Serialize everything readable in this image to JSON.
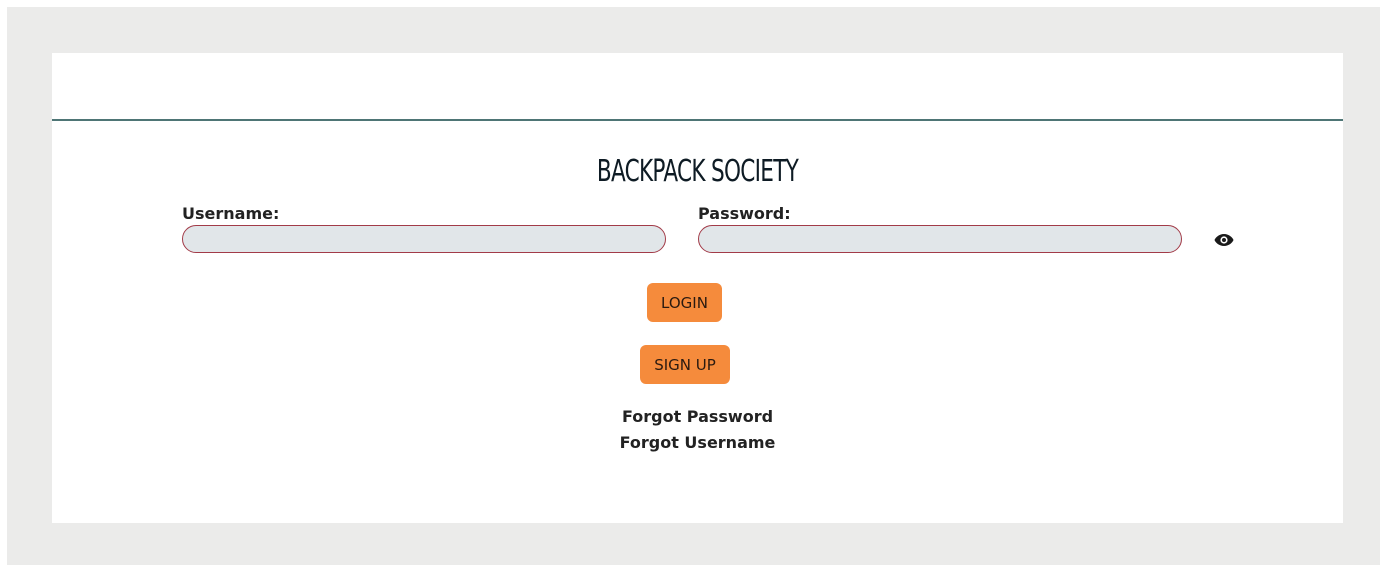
{
  "header": {
    "brand_title": "BACKPACK SOCIETY"
  },
  "login_form": {
    "username_label": "Username:",
    "username_value": "",
    "password_label": "Password:",
    "password_value": "",
    "show_password_icon": "eye-icon",
    "login_label": "LOGIN",
    "signup_label": "SIGN UP",
    "forgot_password_label": "Forgot Password",
    "forgot_username_label": "Forgot Username"
  },
  "colors": {
    "page_background": "#ebebea",
    "card_background": "#ffffff",
    "header_rule": "#4e7575",
    "input_background": "#e1e6e9",
    "input_border": "#a23b48",
    "button_background": "#f58b3c",
    "title_text": "#0e1b24"
  }
}
